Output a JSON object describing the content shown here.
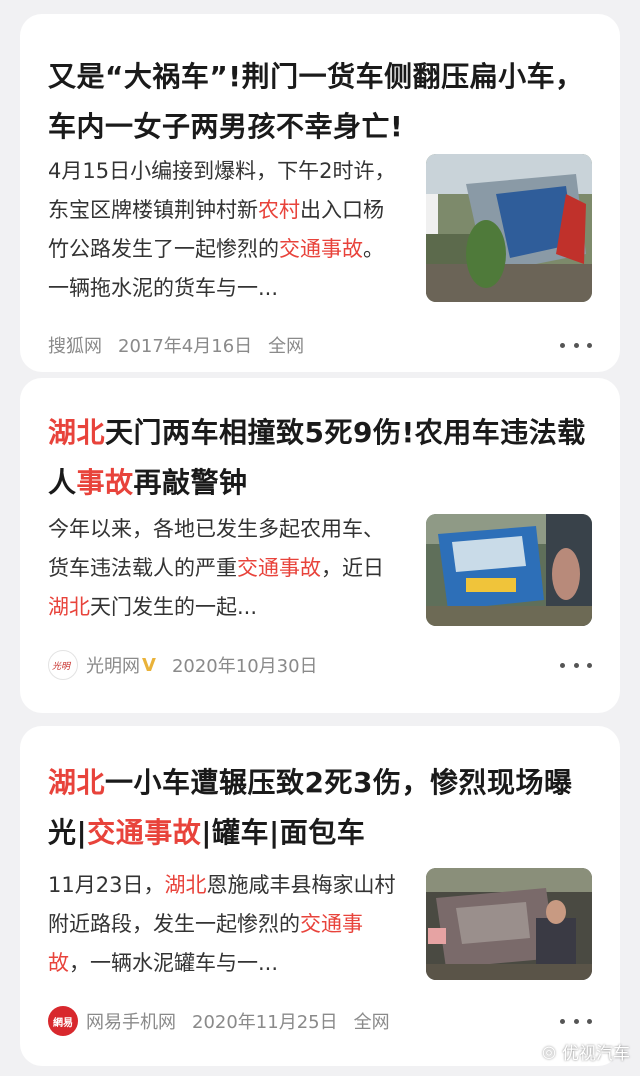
{
  "cards": [
    {
      "title": "又是“大祸车”!荆门一货车侧翻压扁小车，车内一女子两男孩不幸身亡!",
      "snippet": [
        {
          "t": "4月15日小编接到爆料，下午2时许，东宝区牌楼镇荆钟村新",
          "hl": false
        },
        {
          "t": "农村",
          "hl": true
        },
        {
          "t": "出入口杨竹公路发生了一起惨烈的",
          "hl": false
        },
        {
          "t": "交通事故",
          "hl": true
        },
        {
          "t": "。一辆拖水泥的货车与一...",
          "hl": false
        }
      ],
      "source": "搜狐网",
      "date": "2017年4月16日",
      "scope": "全网",
      "thumb_icon": "overturned-truck-photo"
    },
    {
      "title_parts": [
        {
          "t": "湖北",
          "hl": true
        },
        {
          "t": "天门两车相撞致5死9伤!农用车违法载人",
          "hl": false
        },
        {
          "t": "事故",
          "hl": true
        },
        {
          "t": "再敲警钟",
          "hl": false
        }
      ],
      "snippet": [
        {
          "t": "今年以来，各地已发生多起农用车、货车违法载人的严重",
          "hl": false
        },
        {
          "t": "交通事",
          "hl": true
        },
        {
          "t": "故",
          "hl": true
        },
        {
          "t": "，近日",
          "hl": false
        },
        {
          "t": "湖北",
          "hl": true
        },
        {
          "t": "天门发生的一起...",
          "hl": false
        }
      ],
      "source": "光明网",
      "verified": "V",
      "date": "2020年10月30日",
      "thumb_icon": "blue-truck-photo"
    },
    {
      "title_parts": [
        {
          "t": "湖北",
          "hl": true
        },
        {
          "t": "一小车遭辗压致2死3伤，惨烈现场曝光|",
          "hl": false
        },
        {
          "t": "交通事故",
          "hl": true
        },
        {
          "t": "|罐车|面包车",
          "hl": false
        }
      ],
      "snippet": [
        {
          "t": "11月23日，",
          "hl": false
        },
        {
          "t": "湖北",
          "hl": true
        },
        {
          "t": "恩施咸丰县梅家山村附近路段，发生一起惨烈的",
          "hl": false
        },
        {
          "t": "交通事故",
          "hl": true
        },
        {
          "t": "，一辆水泥罐车与一...",
          "hl": false
        }
      ],
      "source": "网易手机网",
      "date": "2020年11月25日",
      "scope": "全网",
      "thumb_icon": "crushed-car-photo"
    }
  ],
  "source_logos": {
    "guangming": "光明网-logo",
    "netease": "網易"
  },
  "watermark": "优视汽车",
  "colors": {
    "highlight": "#e8433b",
    "background": "#f1f1f3",
    "card": "#ffffff",
    "meta": "#8a8a8a"
  }
}
